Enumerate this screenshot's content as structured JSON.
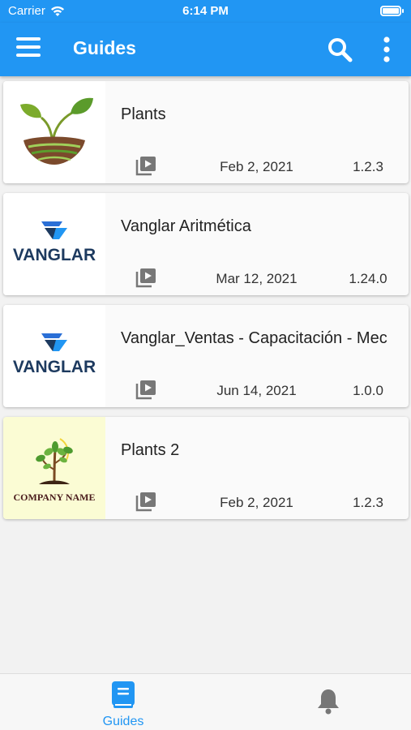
{
  "status_bar": {
    "carrier": "Carrier",
    "time": "6:14 PM"
  },
  "app_bar": {
    "title": "Guides"
  },
  "guides": [
    {
      "name": "Plants",
      "date": "Feb 2, 2021",
      "version": "1.2.3",
      "thumb": "plant-logo"
    },
    {
      "name": "Vanglar Aritmética",
      "date": "Mar 12, 2021",
      "version": "1.24.0",
      "thumb": "vanglar-logo",
      "logo_text": "VANGLAR"
    },
    {
      "name": "Vanglar_Ventas - Capacitación - Mec",
      "date": "Jun 14, 2021",
      "version": "1.0.0",
      "thumb": "vanglar-logo",
      "logo_text": "VANGLAR"
    },
    {
      "name": "Plants 2",
      "date": "Feb 2, 2021",
      "version": "1.2.3",
      "thumb": "company-plant-logo",
      "logo_text": "COMPANY NAME"
    }
  ],
  "bottom_nav": {
    "guides_label": "Guides"
  },
  "colors": {
    "primary": "#2196f3",
    "icon_gray": "#777777",
    "logo_navy": "#1d3a5f"
  }
}
